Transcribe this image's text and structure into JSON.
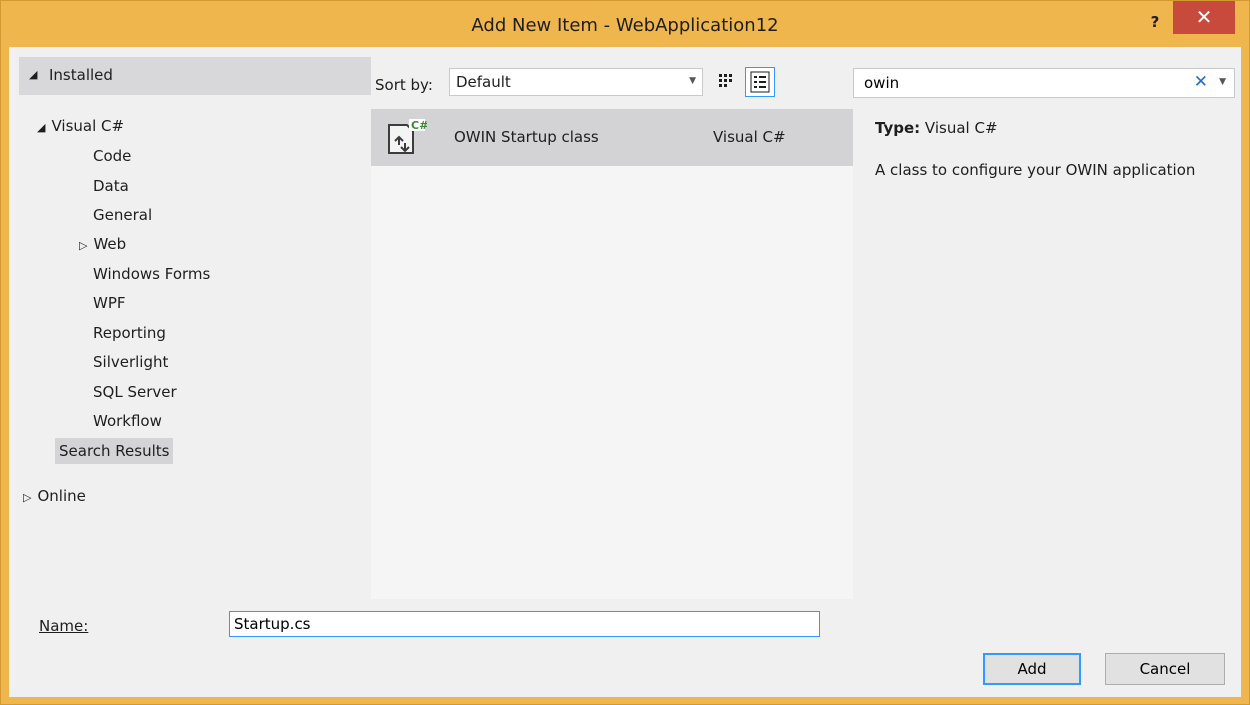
{
  "window": {
    "title": "Add New Item - WebApplication12",
    "help": "?",
    "close": "✕"
  },
  "left": {
    "installed": "Installed",
    "visual_csharp": "Visual C#",
    "children": [
      "Code",
      "Data",
      "General",
      "Web",
      "Windows Forms",
      "WPF",
      "Reporting",
      "Silverlight",
      "SQL Server",
      "Workflow"
    ],
    "search_results": "Search Results",
    "online": "Online"
  },
  "toolbar": {
    "sort_label": "Sort by:",
    "sort_value": "Default"
  },
  "items": [
    {
      "name": "OWIN Startup class",
      "language": "Visual C#"
    }
  ],
  "search": {
    "value": "owin"
  },
  "details": {
    "type_label": "Type:",
    "type_value": "Visual C#",
    "description": "A class to configure your OWIN application"
  },
  "footer": {
    "name_label": "Name:",
    "name_value": "Startup.cs",
    "add": "Add",
    "cancel": "Cancel"
  },
  "colors": {
    "title_bar": "#f0b64e",
    "accent": "#3399ff",
    "close": "#c74a3c"
  },
  "icons": [
    "help-icon",
    "close-icon",
    "collapse-arrow-icon",
    "expand-arrow-icon",
    "medium-icons-view-icon",
    "list-view-icon",
    "csharp-file-icon",
    "clear-search-icon",
    "dropdown-arrow-icon"
  ]
}
